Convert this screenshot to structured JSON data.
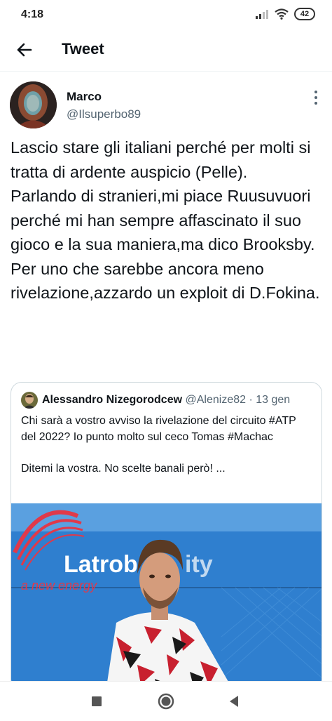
{
  "status_bar": {
    "time": "4:18",
    "battery": "42",
    "icons": [
      "signal-icon",
      "wifi-icon",
      "battery-icon"
    ]
  },
  "header": {
    "title": "Tweet",
    "back_icon": "arrow-left-icon"
  },
  "tweet": {
    "author_name": "Marco",
    "author_handle": "@Ilsuperbo89",
    "text": "Lascio stare gli italiani perché per molti si tratta di ardente auspicio (Pelle).\nParlando di stranieri,mi piace Ruusuvuori perché mi han sempre affascinato il suo gioco e la sua maniera,ma dico Brooksby.\nPer uno che sarebbe ancora meno rivelazione,azzardo un exploit di D.Fokina.",
    "more_icon": "more-vertical-icon"
  },
  "quote": {
    "author_name": "Alessandro Nizegorodcew",
    "author_handle": "@Alenize82",
    "separator": "·",
    "time": "13 gen",
    "text": "Chi sarà a vostro avviso la rivelazione del circuito #ATP del 2022? Io punto molto sul ceco Tomas #Machac\n\nDitemi la vostra. No scelte banali però! ...",
    "image": {
      "banner_brand": "Latrob",
      "banner_brand_tail": "ity",
      "banner_tagline": "a new energy"
    }
  },
  "colors": {
    "text_primary": "#0f1419",
    "text_secondary": "#536471",
    "border": "#cfd9de",
    "banner_blue": "#2f7fcf",
    "banner_red": "#e0394a"
  },
  "nav_bar": {
    "icons": [
      "square-recents-icon",
      "circle-home-icon",
      "triangle-back-icon"
    ]
  }
}
